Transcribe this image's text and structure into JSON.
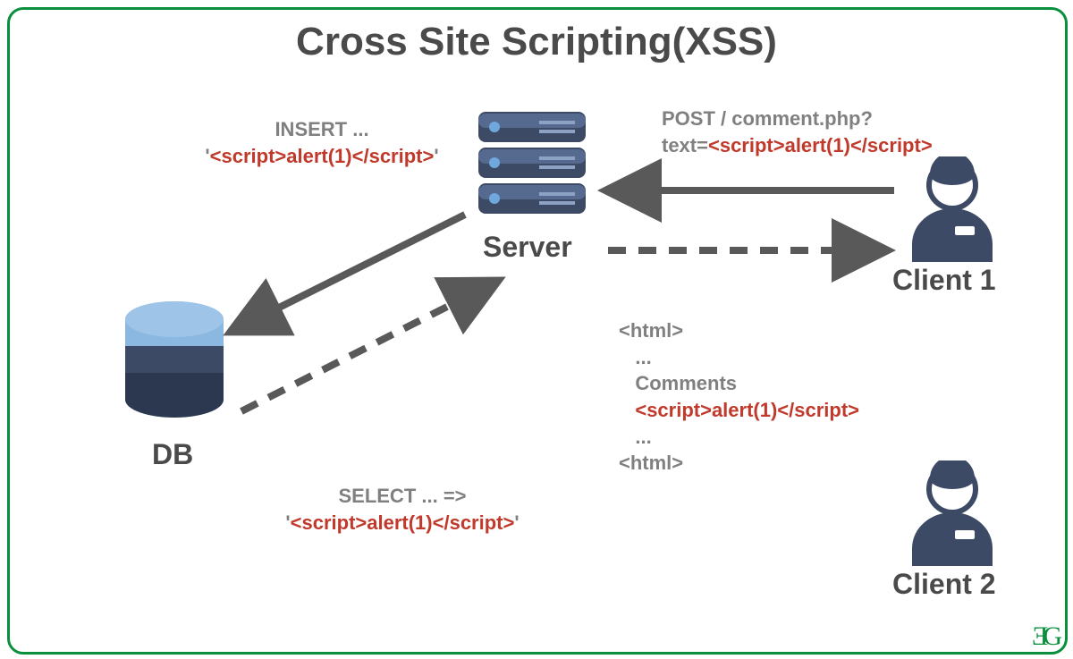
{
  "title": "Cross Site Scripting(XSS)",
  "nodes": {
    "server": {
      "label": "Server"
    },
    "db": {
      "label": "DB"
    },
    "client1": {
      "label": "Client 1"
    },
    "client2": {
      "label": "Client 2"
    }
  },
  "annotations": {
    "insert": {
      "line1": "INSERT ...",
      "line2_q": "'",
      "line2_code": "<script>alert(1)</script>",
      "line2_qend": "'"
    },
    "post": {
      "line1": "POST / comment.php?",
      "line2_pre": "text=",
      "line2_code": "<script>alert(1)</script>"
    },
    "select": {
      "line1": "SELECT ... =>",
      "line2_q": "'",
      "line2_code": "<script>alert(1)</script>",
      "line2_qend": "'"
    },
    "response": {
      "l1": "<html>",
      "l2": "...",
      "l3": "Comments",
      "l4_code": "<script>alert(1)</script>",
      "l5": "...",
      "l6": "<html>"
    }
  },
  "logo": "ƎG"
}
